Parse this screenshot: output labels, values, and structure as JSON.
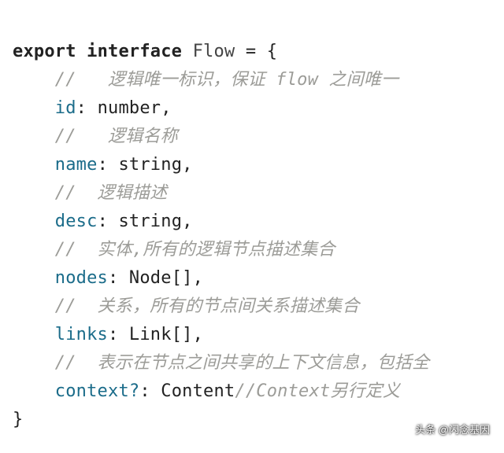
{
  "code": {
    "line1": {
      "kw1": "export",
      "kw2": "interface",
      "typename": "Flow",
      "eq": "=",
      "open": "{"
    },
    "comment1": "//   逻辑唯一标识，保证 flow 之间唯一",
    "prop1": {
      "name": "id",
      "type": "number",
      "sep": ":",
      "term": ","
    },
    "comment2": "//   逻辑名称",
    "prop2": {
      "name": "name",
      "type": "string",
      "sep": ":",
      "term": ","
    },
    "comment3": "//  逻辑描述",
    "prop3": {
      "name": "desc",
      "type": "string",
      "sep": ":",
      "term": ","
    },
    "comment4": "//  实体,所有的逻辑节点描述集合",
    "prop4": {
      "name": "nodes",
      "type": "Node[]",
      "sep": ":",
      "term": ","
    },
    "comment5": "//  关系，所有的节点间关系描述集合",
    "prop5": {
      "name": "links",
      "type": "Link[]",
      "sep": ":",
      "term": ","
    },
    "comment6": "//  表示在节点之间共享的上下文信息，包括全",
    "prop6": {
      "name": "context?",
      "type": "Content",
      "sep": ":",
      "trail_comment": "//Context另行定义"
    },
    "close": "}"
  },
  "indent": "    ",
  "watermark": {
    "text": "头条 @闪念基因",
    "icon_name": "toutiao-icon"
  }
}
